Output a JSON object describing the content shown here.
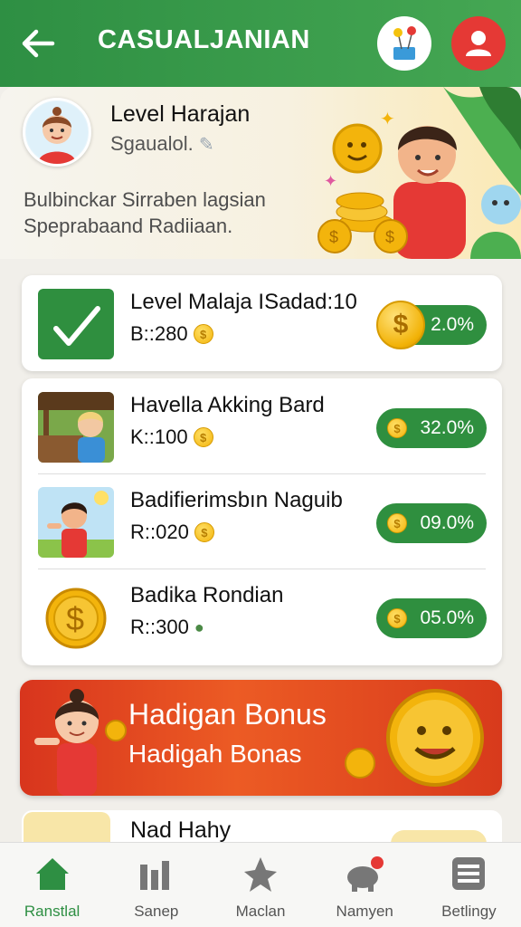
{
  "header": {
    "title": "CASUALJANIAN",
    "back_icon": "arrow-left-icon",
    "action_icons": [
      "balloons-icon",
      "user-icon"
    ]
  },
  "profile": {
    "name": "Level Harajan",
    "subtitle": "Sgaualol.",
    "description": "Bulbinckar Sirraben lagsian Speprabaand Radiiaan."
  },
  "level_card": {
    "title": "Level Malaja ISadad:10",
    "meta": "B::280",
    "badge": "2.0%",
    "icon": "check-icon"
  },
  "list": [
    {
      "title": "Havella Akking Bard",
      "meta": "K::100",
      "badge": "32.0%"
    },
    {
      "title": "Badifierimsbın Naguib",
      "meta": "R::020",
      "badge": "09.0%"
    },
    {
      "title": "Badika Rondian",
      "meta": "R::300",
      "badge": "05.0%"
    }
  ],
  "bonus": {
    "title": "Hadigan Bonus",
    "subtitle": "Hadigah Bonas"
  },
  "peek": {
    "title": "Nad Hahy"
  },
  "nav": [
    {
      "label": "Ranstlal",
      "icon": "home-icon",
      "active": true
    },
    {
      "label": "Sanep",
      "icon": "tools-icon",
      "active": false
    },
    {
      "label": "Maclan",
      "icon": "star-person-icon",
      "active": false
    },
    {
      "label": "Namyen",
      "icon": "piggy-bank-icon",
      "active": false
    },
    {
      "label": "Betlingy",
      "icon": "list-icon",
      "active": false
    }
  ],
  "colors": {
    "brand_green": "#2e8f43",
    "bonus_red": "#d8351d",
    "coin_gold": "#f3b40c"
  }
}
